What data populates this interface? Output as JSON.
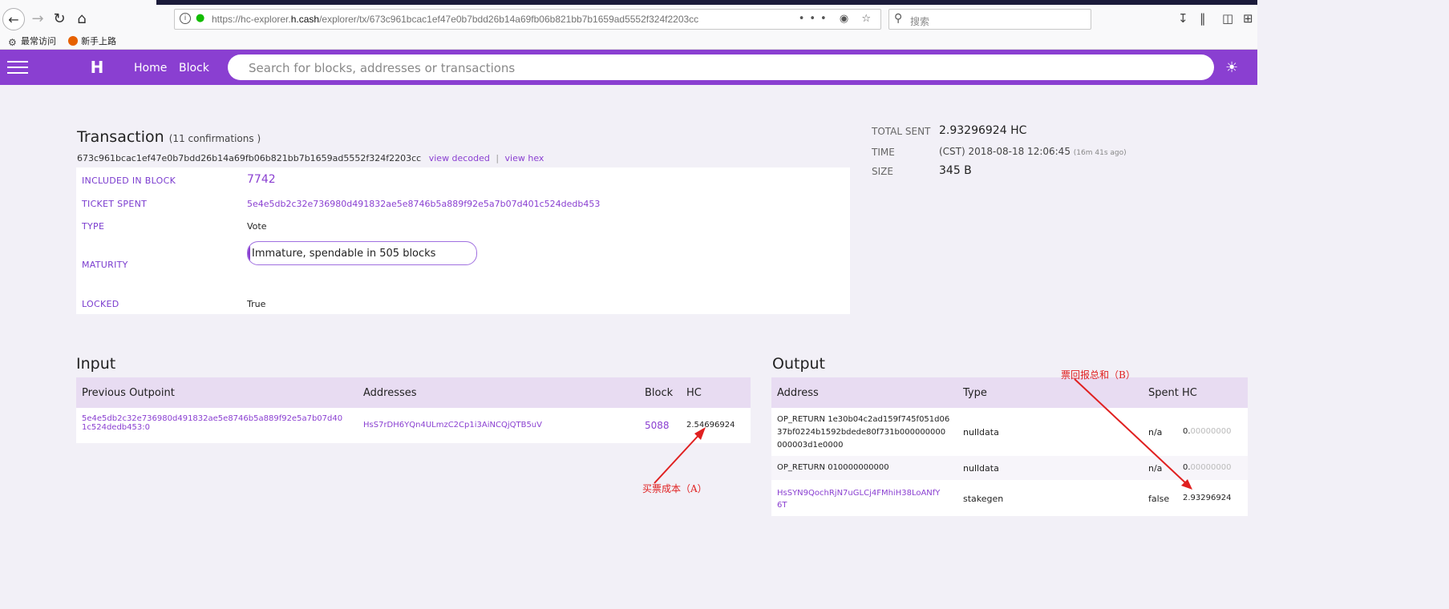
{
  "browser": {
    "url_prefix": "https://hc-explorer.",
    "url_host": "h.cash",
    "url_path": "/explorer/tx/673c961bcac1ef47e0b7bdd26b14a69fb06b821bb7b1659ad5552f324f2203cc",
    "url_more": "•••",
    "search_placeholder": "搜索",
    "bookmarks": [
      "最常访问",
      "新手上路"
    ]
  },
  "site": {
    "nav": [
      "Home",
      "Block"
    ],
    "search_placeholder": "Search for blocks, addresses or transactions",
    "brand_color": "#8a3fd1"
  },
  "tx": {
    "title": "Transaction",
    "confirmations": "(11 confirmations )",
    "hash": "673c961bcac1ef47e0b7bdd26b14a69fb06b821bb7b1659ad5552f324f2203cc",
    "view_decoded": "view decoded",
    "separator": "|",
    "view_hex": "view hex",
    "fields": {
      "included_in_block_label": "INCLUDED IN BLOCK",
      "included_in_block": "7742",
      "ticket_spent_label": "TICKET SPENT",
      "ticket_spent": "5e4e5db2c32e736980d491832ae5e8746b5a889f92e5a7b07d401c524dedb453",
      "type_label": "TYPE",
      "type": "Vote",
      "maturity_label": "MATURITY",
      "maturity_text": "Immature, spendable in 505 blocks",
      "maturity_progress": 0.01,
      "locked_label": "LOCKED",
      "locked": "True"
    }
  },
  "summary": {
    "total_sent_label": "TOTAL SENT",
    "total_sent": "2.93296924 HC",
    "time_label": "TIME",
    "time": "(CST) 2018-08-18 12:06:45",
    "time_ago": "(16m 41s ago)",
    "size_label": "SIZE",
    "size": "345 B"
  },
  "input": {
    "title": "Input",
    "columns": [
      "Previous Outpoint",
      "Addresses",
      "Block",
      "HC"
    ],
    "rows": [
      {
        "outpoint_line1": "5e4e5db2c32e736980d491832ae5e8746b5a889f92e5a7b07d40",
        "outpoint_line2": "1c524dedb453:0",
        "address": "HsS7rDH6YQn4ULmzC2Cp1i3AiNCQjQTB5uV",
        "block": "5088",
        "hc": "2.54696924"
      }
    ]
  },
  "output": {
    "title": "Output",
    "columns": [
      "Address",
      "Type",
      "Spent",
      "HC"
    ],
    "rows": [
      {
        "address_lines": [
          "OP_RETURN 1e30b04c2ad159f745f051d06",
          "37bf0224b1592bdede80f731b000000000",
          "000003d1e0000"
        ],
        "type": "nulldata",
        "spent": "n/a",
        "hc_int": "0.",
        "hc_zeros": "00000000"
      },
      {
        "address_lines": [
          "OP_RETURN 010000000000"
        ],
        "type": "nulldata",
        "spent": "n/a",
        "hc_int": "0.",
        "hc_zeros": "00000000"
      },
      {
        "address_lines": [
          "HsSYN9QochRjN7uGLCj4FMhiH38LoANfY",
          "6T"
        ],
        "type": "stakegen",
        "spent": "false",
        "hc_int": "2.93296924",
        "hc_zeros": ""
      }
    ]
  },
  "annotations": {
    "cost": "买票成本（A）",
    "reward": "票回报总和（B）"
  }
}
